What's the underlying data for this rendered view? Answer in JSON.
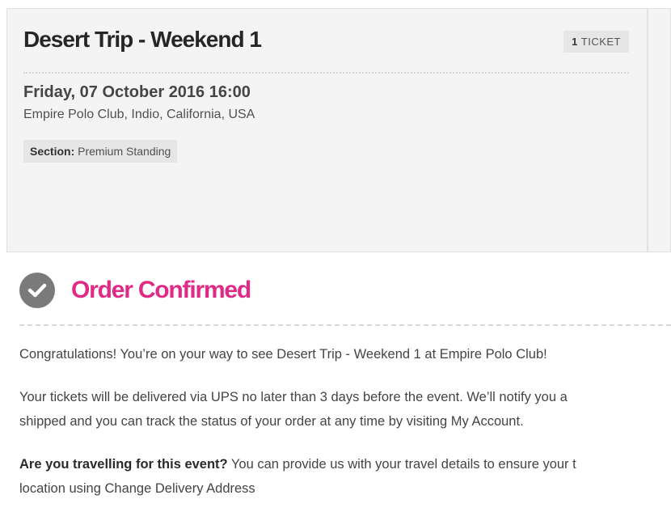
{
  "event": {
    "title": "Desert Trip - Weekend 1",
    "ticket_count": "1",
    "ticket_word": "TICKET",
    "date": "Friday, 07 October 2016 16:00",
    "venue": "Empire Polo Club, Indio, California, USA",
    "section_label": "Section:",
    "section_value": "Premium Standing"
  },
  "confirmation": {
    "icon": "check-circle-icon",
    "title": "Order Confirmed",
    "accent_color": "#e02a86",
    "paragraph1": "Congratulations! You’re on your way to see Desert Trip - Weekend 1 at Empire Polo Club!",
    "paragraph2_line1": "Your tickets will be delivered via UPS no later than 3 days before the event. We’ll notify you a",
    "paragraph2_line2": "shipped and you can track the status of your order at any time by visiting My Account.",
    "paragraph3_bold": "Are you travelling for this event?",
    "paragraph3_line1": " You can provide us with your travel details to ensure your t",
    "paragraph3_line2": "location using Change Delivery Address"
  }
}
